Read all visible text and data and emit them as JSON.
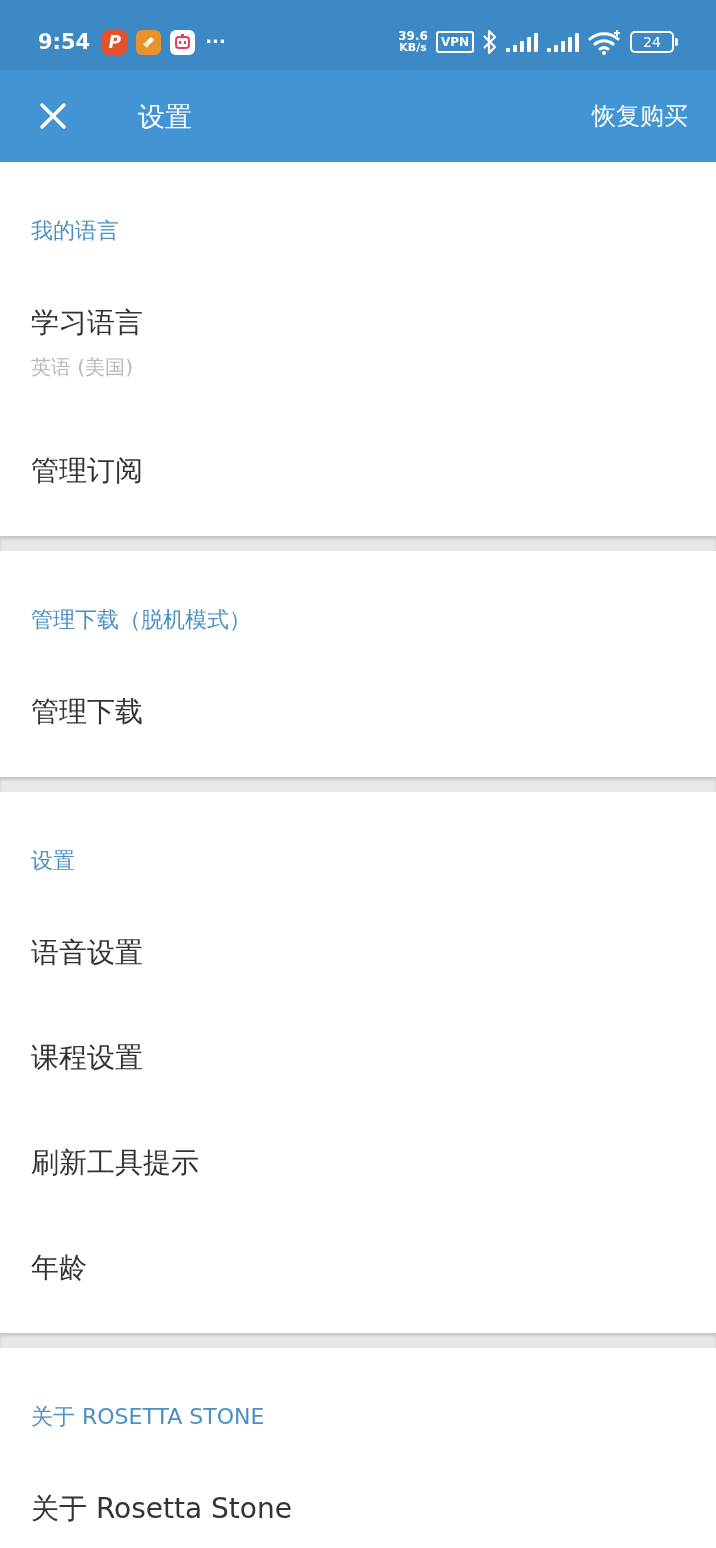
{
  "status_bar": {
    "time": "9:54",
    "notification_icons": [
      {
        "kind": "letter",
        "text": "P",
        "color": "#e2532b"
      },
      {
        "kind": "brush",
        "color": "#e8922c"
      },
      {
        "kind": "robot",
        "color": "#ffffff"
      }
    ],
    "more": "···",
    "network_speed": {
      "value": "39.6",
      "unit": "KB/s"
    },
    "vpn": "VPN",
    "battery": "24"
  },
  "app_bar": {
    "title": "设置",
    "action": "恢复购买"
  },
  "sections": [
    {
      "header": "我的语言",
      "items": [
        {
          "label": "学习语言",
          "subtitle": "英语 (美国)"
        },
        {
          "label": "管理订阅"
        }
      ]
    },
    {
      "header": "管理下载（脱机模式）",
      "items": [
        {
          "label": "管理下载"
        }
      ]
    },
    {
      "header": "设置",
      "items": [
        {
          "label": "语音设置"
        },
        {
          "label": "课程设置"
        },
        {
          "label": "刷新工具提示"
        },
        {
          "label": "年龄"
        }
      ]
    },
    {
      "header": "关于 ROSETTA STONE",
      "items": [
        {
          "label": "关于 Rosetta Stone"
        }
      ]
    }
  ]
}
